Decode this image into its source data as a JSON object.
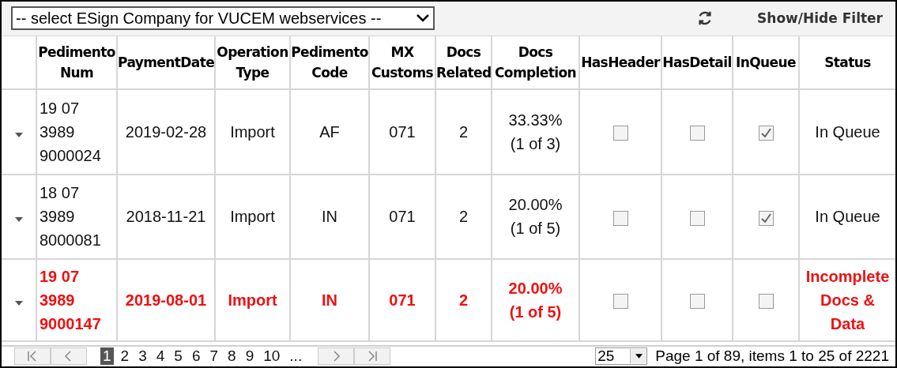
{
  "toolbar": {
    "company_select": {
      "value": "-- select ESign Company for VUCEM webservices --"
    },
    "filter_button": "Show/Hide Filter"
  },
  "table": {
    "columns": [
      "Pedimento Num",
      "PaymentDate",
      "Operation Type",
      "Pedimento Code",
      "MX Customs",
      "Docs Related",
      "Docs Completion",
      "HasHeader",
      "HasDetail",
      "InQueue",
      "Status"
    ],
    "rows": [
      {
        "pedimento_num": "19 07 3989 9000024",
        "payment_date": "2019-02-28",
        "operation_type": "Import",
        "pedimento_code": "AF",
        "mx_customs": "071",
        "docs_related": "2",
        "docs_completion": "33.33% (1 of 3)",
        "has_header": false,
        "has_detail": false,
        "in_queue": true,
        "status": "In Queue",
        "incomplete": false
      },
      {
        "pedimento_num": "18 07 3989 8000081",
        "payment_date": "2018-11-21",
        "operation_type": "Import",
        "pedimento_code": "IN",
        "mx_customs": "071",
        "docs_related": "2",
        "docs_completion": "20.00% (1 of 5)",
        "has_header": false,
        "has_detail": false,
        "in_queue": true,
        "status": "In Queue",
        "incomplete": false
      },
      {
        "pedimento_num": "19 07 3989 9000147",
        "payment_date": "2019-08-01",
        "operation_type": "Import",
        "pedimento_code": "IN",
        "mx_customs": "071",
        "docs_related": "2",
        "docs_completion": "20.00% (1 of 5)",
        "has_header": false,
        "has_detail": false,
        "in_queue": false,
        "status": "Incomplete Docs & Data",
        "incomplete": true
      }
    ]
  },
  "pager": {
    "pages": [
      {
        "label": "1",
        "selected": true
      },
      {
        "label": "2",
        "selected": false
      },
      {
        "label": "3",
        "selected": false
      },
      {
        "label": "4",
        "selected": false
      },
      {
        "label": "5",
        "selected": false
      },
      {
        "label": "6",
        "selected": false
      },
      {
        "label": "7",
        "selected": false
      },
      {
        "label": "8",
        "selected": false
      },
      {
        "label": "9",
        "selected": false
      },
      {
        "label": "10",
        "selected": false
      },
      {
        "label": "...",
        "selected": false
      }
    ],
    "page_size": "25",
    "info": "Page 1 of 89, items 1 to 25 of 2221"
  }
}
